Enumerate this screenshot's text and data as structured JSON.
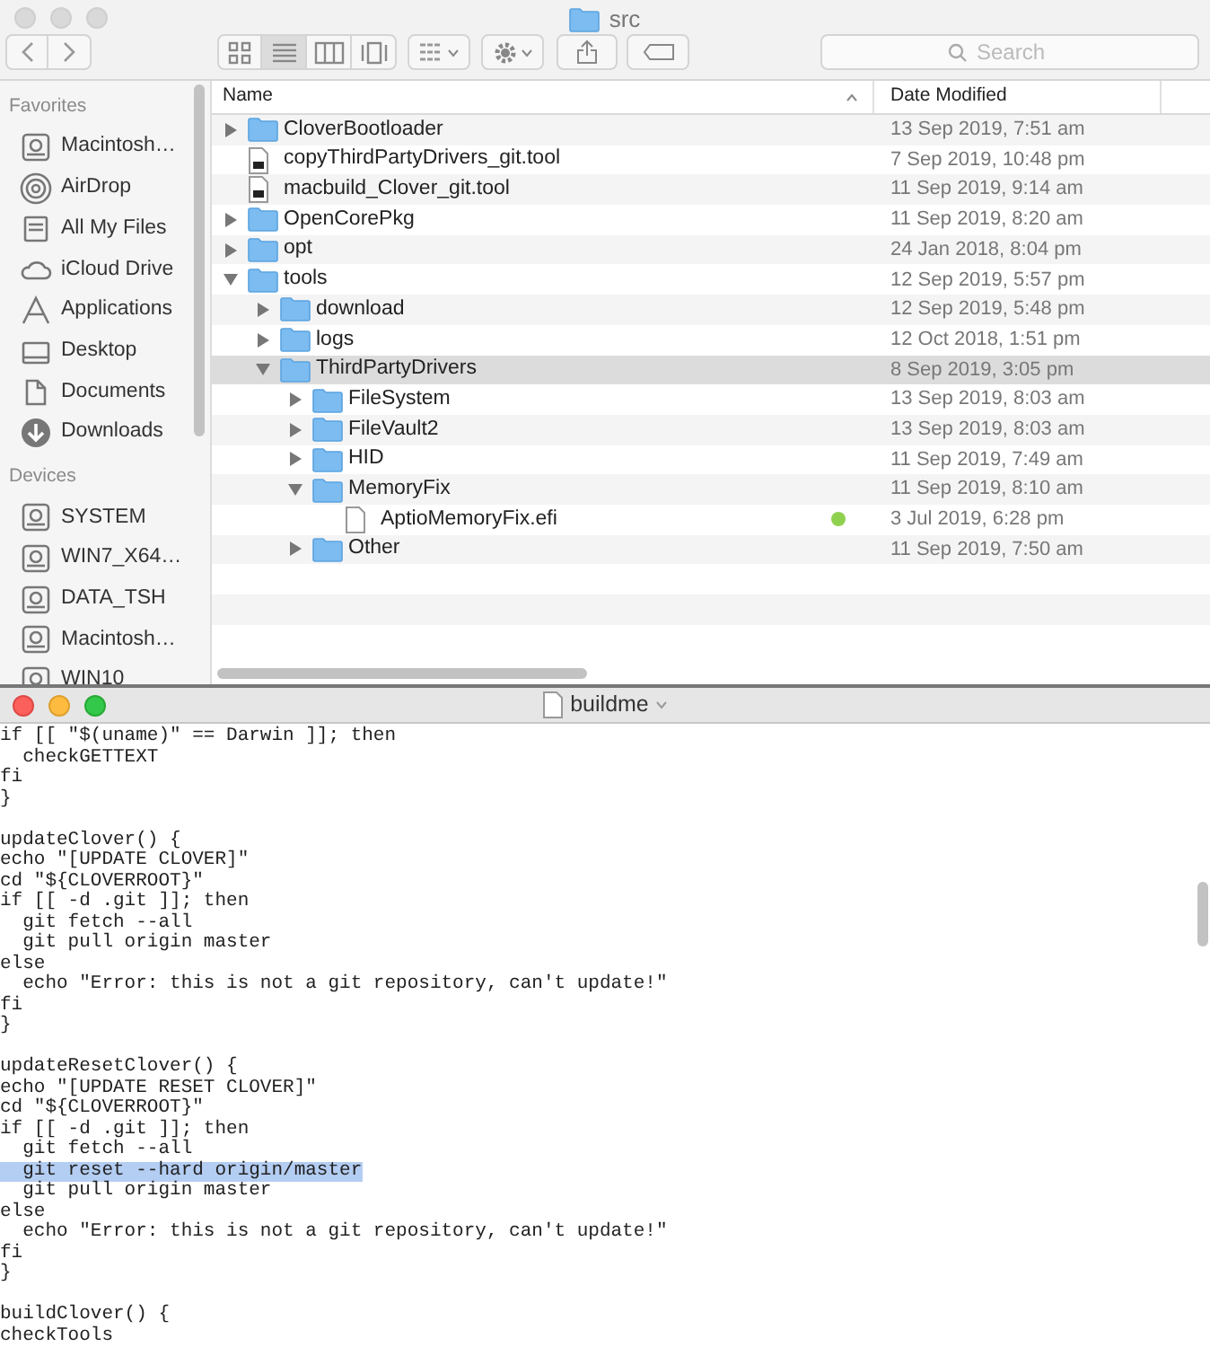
{
  "finder": {
    "title": "src",
    "view_modes": [
      {
        "selected": false
      },
      {
        "selected": true
      },
      {
        "selected": false
      },
      {
        "selected": false
      }
    ],
    "search": {
      "placeholder": "Search"
    },
    "sidebar": [
      {
        "heading": "Favorites",
        "items": [
          {
            "label": "Macintosh…",
            "kind": "disk"
          },
          {
            "label": "AirDrop",
            "kind": "airdrop"
          },
          {
            "label": "All My Files",
            "kind": "files"
          },
          {
            "label": "iCloud Drive",
            "kind": "cloud"
          },
          {
            "label": "Applications",
            "kind": "apps"
          },
          {
            "label": "Desktop",
            "kind": "desktop"
          },
          {
            "label": "Documents",
            "kind": "documents"
          },
          {
            "label": "Downloads",
            "kind": "downloads"
          }
        ]
      },
      {
        "heading": "Devices",
        "items": [
          {
            "label": "SYSTEM",
            "kind": "disk"
          },
          {
            "label": "WIN7_X64…",
            "kind": "disk"
          },
          {
            "label": "DATA_TSH",
            "kind": "disk"
          },
          {
            "label": "Macintosh…",
            "kind": "disk"
          },
          {
            "label": "WIN10",
            "kind": "disk"
          }
        ]
      }
    ],
    "columns": [
      "Name",
      "Date Modified"
    ],
    "rows": [
      {
        "name": "CloverBootloader",
        "kind": "folder",
        "expanded": false,
        "selected": false,
        "date": "13 Sep 2019, 7:51 am"
      },
      {
        "name": "copyThirdPartyDrivers_git.tool",
        "kind": "script",
        "selected": false,
        "date": "7 Sep 2019, 10:48 pm"
      },
      {
        "name": "macbuild_Clover_git.tool",
        "kind": "script",
        "selected": false,
        "date": "11 Sep 2019, 9:14 am"
      },
      {
        "name": "OpenCorePkg",
        "kind": "folder",
        "expanded": false,
        "selected": false,
        "date": "11 Sep 2019, 8:20 am"
      },
      {
        "name": "opt",
        "kind": "folder",
        "expanded": false,
        "selected": false,
        "date": "24 Jan 2018, 8:04 pm"
      },
      {
        "name": "tools",
        "kind": "folder",
        "expanded": true,
        "selected": false,
        "date": "12 Sep 2019, 5:57 pm",
        "children": [
          {
            "name": "download",
            "kind": "folder",
            "expanded": false,
            "selected": false,
            "date": "12 Sep 2019, 5:48 pm"
          },
          {
            "name": "logs",
            "kind": "folder",
            "expanded": false,
            "selected": false,
            "date": "12 Oct 2018, 1:51 pm"
          },
          {
            "name": "ThirdPartyDrivers",
            "kind": "folder",
            "expanded": true,
            "selected": true,
            "date": "8 Sep 2019, 3:05 pm",
            "children": [
              {
                "name": "FileSystem",
                "kind": "folder",
                "expanded": false,
                "selected": false,
                "date": "13 Sep 2019, 8:03 am"
              },
              {
                "name": "FileVault2",
                "kind": "folder",
                "expanded": false,
                "selected": false,
                "date": "13 Sep 2019, 8:03 am"
              },
              {
                "name": "HID",
                "kind": "folder",
                "expanded": false,
                "selected": false,
                "date": "11 Sep 2019, 7:49 am"
              },
              {
                "name": "MemoryFix",
                "kind": "folder",
                "expanded": true,
                "selected": false,
                "date": "11 Sep 2019, 8:10 am",
                "children": [
                  {
                    "name": "AptioMemoryFix.efi",
                    "kind": "file",
                    "selected": false,
                    "color": "#8fd14f",
                    "date": "3 Jul 2019, 6:28 pm"
                  }
                ]
              },
              {
                "name": "Other",
                "kind": "folder",
                "expanded": false,
                "selected": false,
                "date": "11 Sep 2019, 7:50 am"
              }
            ]
          }
        ]
      }
    ]
  },
  "editor": {
    "title": "buildme",
    "blocks": [
      {
        "lines": [
          {
            "text": "if [[ \"$(uname)\" == Darwin ]]; then",
            "selected": false
          },
          {
            "text": "  checkGETTEXT",
            "selected": false
          },
          {
            "text": "fi",
            "selected": false
          },
          {
            "text": "}",
            "selected": false
          }
        ]
      },
      {
        "lines": [
          {
            "text": "updateClover() {",
            "selected": false
          },
          {
            "text": "echo \"[UPDATE CLOVER]\"",
            "selected": false
          },
          {
            "text": "cd \"${CLOVERROOT}\"",
            "selected": false
          },
          {
            "text": "if [[ -d .git ]]; then",
            "selected": false
          },
          {
            "text": "  git fetch --all",
            "selected": false
          },
          {
            "text": "  git pull origin master",
            "selected": false
          },
          {
            "text": "else",
            "selected": false
          },
          {
            "text": "  echo \"Error: this is not a git repository, can't update!\"",
            "selected": false
          },
          {
            "text": "fi",
            "selected": false
          },
          {
            "text": "}",
            "selected": false
          }
        ]
      },
      {
        "lines": [
          {
            "text": "updateResetClover() {",
            "selected": false
          },
          {
            "text": "echo \"[UPDATE RESET CLOVER]\"",
            "selected": false
          },
          {
            "text": "cd \"${CLOVERROOT}\"",
            "selected": false
          },
          {
            "text": "if [[ -d .git ]]; then",
            "selected": false
          },
          {
            "text": "  git fetch --all",
            "selected": false
          },
          {
            "text": "  git reset --hard origin/master",
            "selected": true
          },
          {
            "text": "  git pull origin master",
            "selected": false
          },
          {
            "text": "else",
            "selected": false
          },
          {
            "text": "  echo \"Error: this is not a git repository, can't update!\"",
            "selected": false
          },
          {
            "text": "fi",
            "selected": false
          },
          {
            "text": "}",
            "selected": false
          }
        ]
      },
      {
        "lines": [
          {
            "text": "buildClover() {",
            "selected": false
          },
          {
            "text": "checkTools",
            "selected": false
          }
        ]
      }
    ]
  }
}
